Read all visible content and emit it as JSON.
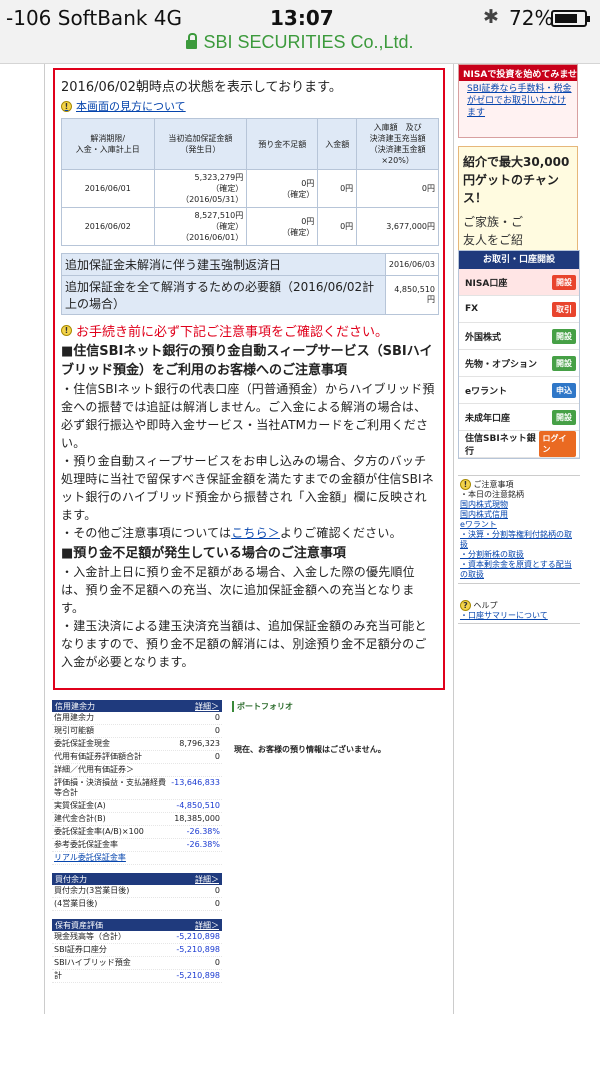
{
  "status": {
    "carrier": "-106 SoftBank   4G",
    "time": "13:07",
    "battery": "72%",
    "url": "SBI SECURITIES Co.,Ltd."
  },
  "alert": {
    "title": "2016/06/02朝時点の状態を表示しております。",
    "howto_link": "本画面の見方について",
    "table_headers": [
      "解消期限/\n入金・入庫計上日",
      "当初追加保証金額\n（発生日）",
      "預り金不足額",
      "入金額",
      "入庫額　及び\n決済建玉充当額\n（決済建玉金額\n×20%）"
    ],
    "rows": [
      {
        "date": "2016/06/01",
        "amount": "5,323,279円",
        "amount_note": "（確定）",
        "amount_date": "（2016/05/31）",
        "shortage": "0円",
        "shortage_note": "（確定）",
        "deposit": "0円",
        "inbound": "0円"
      },
      {
        "date": "2016/06/02",
        "amount": "8,527,510円",
        "amount_note": "（確定）",
        "amount_date": "（2016/06/01）",
        "shortage": "0円",
        "shortage_note": "（確定）",
        "deposit": "0円",
        "inbound": "3,677,000円"
      }
    ],
    "forced_label": "追加保証金未解消に伴う建玉強制返済日",
    "forced_value": "2016/06/03",
    "required_label": "追加保証金を全て解消するための必要額（2016/06/02計上の場合）",
    "required_value": "4,850,510円",
    "warning": "お手続き前に必ず下記ご注意事項をご確認ください。",
    "h1": "■住信SBIネット銀行の預り金自動スィープサービス（SBIハイブリッド預金）をご利用のお客様へのご注意事項",
    "p1": "・住信SBIネット銀行の代表口座（円普通預金）からハイブリッド預金への振替では追証は解消しません。ご入金による解消の場合は、必ず銀行振込や即時入金サービス・当社ATMカードをご利用ください。",
    "p2": "・預り金自動スィープサービスをお申し込みの場合、夕方のバッチ処理時に当社で留保すべき保証金額を満たすまでの金額が住信SBIネット銀行のハイブリッド預金から振替され「入金額」欄に反映されます。",
    "p3_pre": "・その他ご注意事項については",
    "p3_link": "こちら＞",
    "p3_post": "よりご確認ください。",
    "h2": "■預り金不足額が発生している場合のご注意事項",
    "p4": "・入金計上日に預り金不足額がある場合、入金した際の優先順位は、預り金不足額への充当、次に追加保証金額への充当となります。",
    "p5": "・建玉決済による建玉決済充当額は、追加保証金額のみ充当可能となりますので、預り金不足額の解消には、別途預り金不足額分のご入金が必要となります。"
  },
  "credit": {
    "title": "信用建余力",
    "detail": "詳細＞",
    "rows": [
      {
        "label": "信用建余力",
        "value": "0"
      },
      {
        "label": "現引可能額",
        "value": "0"
      },
      {
        "label": "委託保証金現金",
        "value": "8,796,323"
      },
      {
        "label": "代用有価証券評価額合計",
        "value": "0"
      },
      {
        "label": "詳細／代用有価証券＞",
        "value": ""
      },
      {
        "label": "評価損・決済損益・支払諸経費等合計",
        "value": "-13,646,833"
      },
      {
        "label": "実質保証金(A)",
        "value": "-4,850,510"
      },
      {
        "label": "建代金合計(B)",
        "value": "18,385,000"
      },
      {
        "label": "委託保証金率(A/B)×100",
        "value": "-26.38%"
      },
      {
        "label": "参考委託保証金率",
        "value": "-26.38%"
      }
    ],
    "real_link": "リアル委託保証金率"
  },
  "buy": {
    "title": "買付余力",
    "detail": "詳細＞",
    "rows": [
      {
        "label": "買付余力(3営業日後)",
        "value": "0"
      },
      {
        "label": "(4営業日後)",
        "value": "0"
      }
    ]
  },
  "assets": {
    "title": "保有資産評価",
    "detail": "詳細＞",
    "rows": [
      {
        "label": "現金残高等（合計）",
        "value": "-5,210,898"
      },
      {
        "label": "SBI証券口座分",
        "value": "-5,210,898"
      },
      {
        "label": "SBIハイブリッド預金",
        "value": "0"
      },
      {
        "label": "計",
        "value": "-5,210,898"
      }
    ]
  },
  "portfolio": {
    "title": "ポートフォリオ",
    "message": "現在、お客様の預り情報はございません。"
  },
  "sidebar": {
    "nisa_head": "NISAで投資を始めてみませんか？",
    "nisa_link": "SBI証券なら手数料・税金がゼロでお取引いただけます",
    "promo_big": "紹介で最大30,000円ゲットのチャンス！",
    "promo_sub": "ご家族・ご友人をご紹介",
    "acct_head": "お取引・口座開設",
    "accounts": [
      {
        "label": "NISA口座",
        "btn": "開設",
        "color": "red"
      },
      {
        "label": "FX",
        "btn": "取引",
        "color": "red"
      },
      {
        "label": "外国株式",
        "btn": "開設",
        "color": "green"
      },
      {
        "label": "先物・オプション",
        "btn": "開設",
        "color": "green"
      },
      {
        "label": "eワラント",
        "btn": "申込",
        "color": "blue"
      },
      {
        "label": "未成年口座",
        "btn": "開設",
        "color": "green"
      },
      {
        "label": "住信SBIネット銀行",
        "btn": "ログイン",
        "color": "orange"
      }
    ],
    "notice_title": "ご注意事項",
    "notice_items": [
      "・本日の注意銘柄",
      "国内株式現物",
      "国内株式信用",
      "eワラント",
      "・決算・分割等権利付銘柄の取扱",
      "・分割新株の取扱",
      "・資本剰余金を原資とする配当の取扱"
    ],
    "help_title": "ヘルプ",
    "help_link": "・口座サマリーについて"
  }
}
